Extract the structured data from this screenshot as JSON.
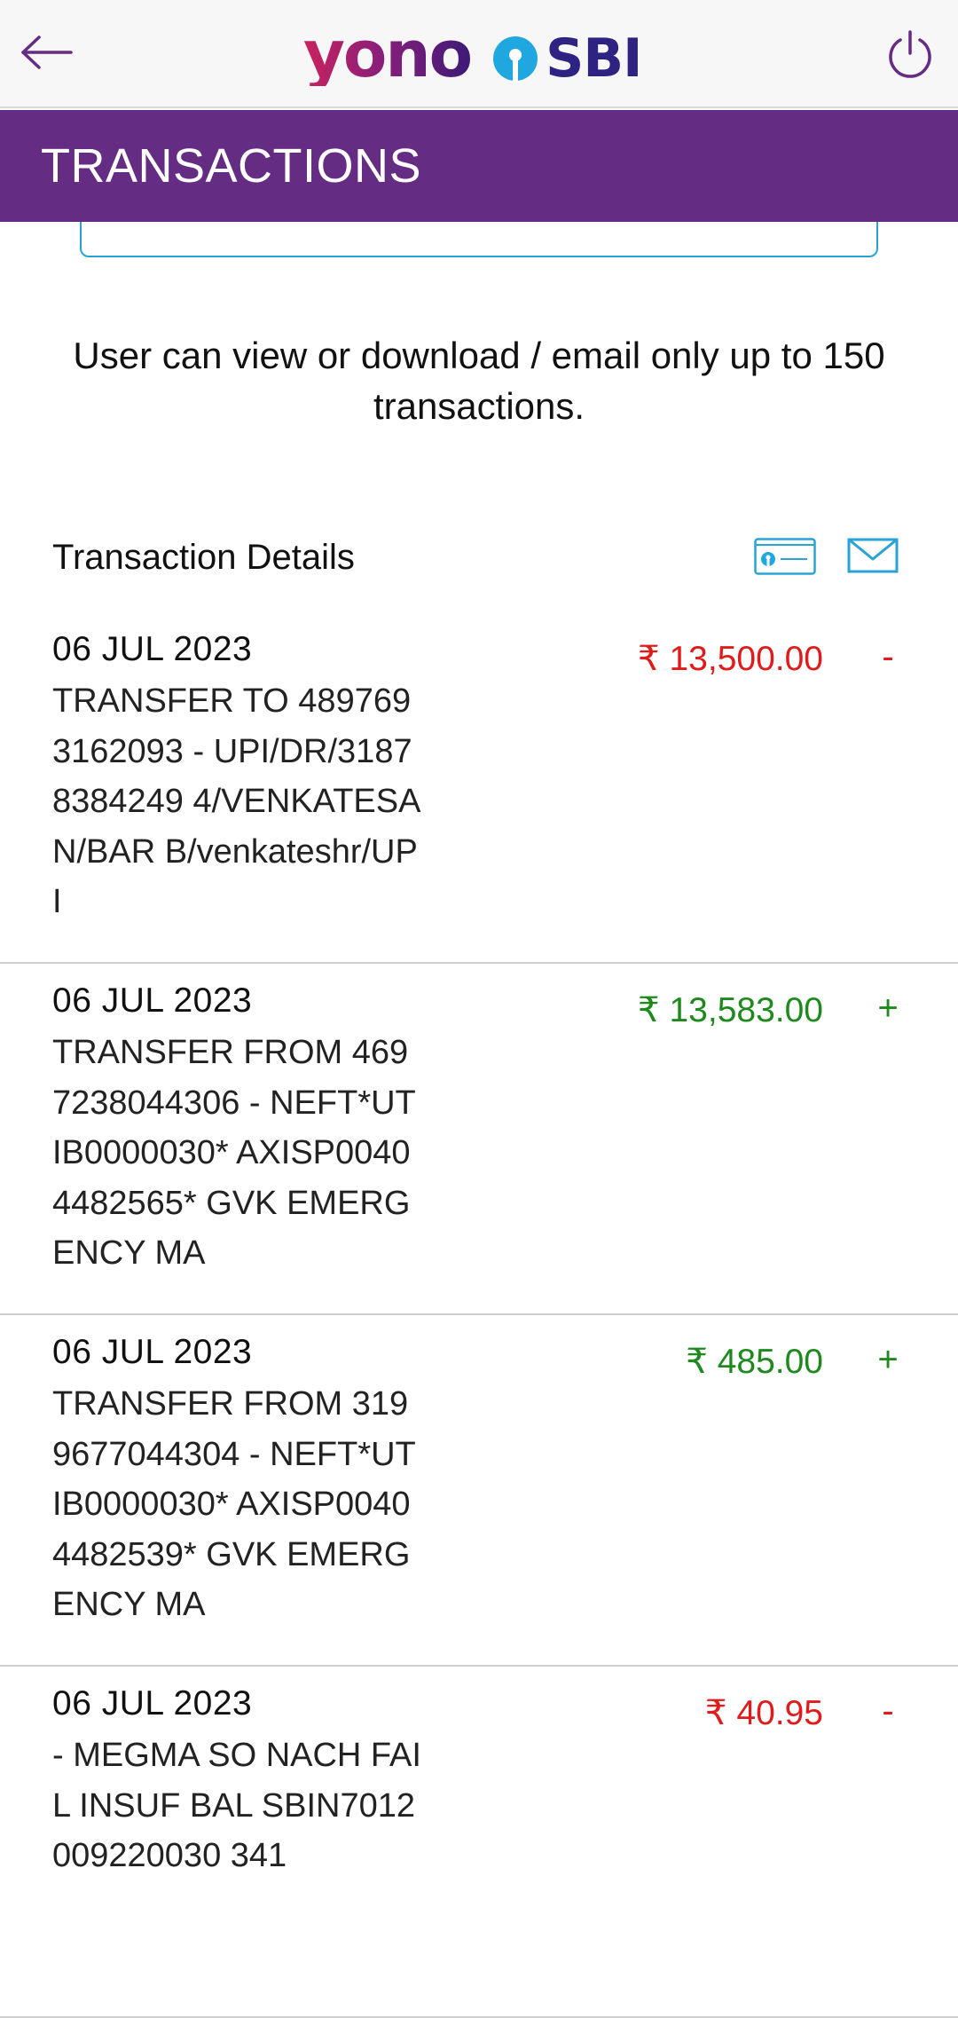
{
  "appbar": {
    "logo_yono": "yono",
    "logo_sbi": "SBI",
    "back_icon": "arrow-left-icon",
    "power_icon": "power-icon"
  },
  "header": {
    "title": "TRANSACTIONS"
  },
  "notice": "User can view or download / email only up to 150 transactions.",
  "details": {
    "label": "Transaction Details",
    "passbook_icon": "passbook-icon",
    "email_icon": "email-icon"
  },
  "transactions": [
    {
      "date": "06 JUL 2023",
      "description": "TRANSFER TO 4897693162093 - UPI/DR/31878384249 4/VENKATESAN/BAR B/venkateshr/UPI",
      "amount": "₹ 13,500.00",
      "sign": "-",
      "type": "debit"
    },
    {
      "date": "06 JUL 2023",
      "description": "TRANSFER FROM 4697238044306 - NEFT*UTIB0000030* AXISP00404482565* GVK EMERGENCY MA",
      "amount": "₹ 13,583.00",
      "sign": "+",
      "type": "credit"
    },
    {
      "date": "06 JUL 2023",
      "description": "TRANSFER FROM 3199677044304 - NEFT*UTIB0000030* AXISP00404482539* GVK EMERGENCY MA",
      "amount": "₹ 485.00",
      "sign": "+",
      "type": "credit"
    },
    {
      "date": "06 JUL 2023",
      "description": "- MEGMA SO NACH FAIL INSUF BAL SBIN7012009220030 341",
      "amount": "₹ 40.95",
      "sign": "-",
      "type": "debit"
    }
  ],
  "colors": {
    "header_purple": "#652c83",
    "debit_red": "#e01b1b",
    "credit_green": "#1e8a1e",
    "accent_blue": "#29a3d3",
    "sbi_navy": "#2e2383"
  }
}
